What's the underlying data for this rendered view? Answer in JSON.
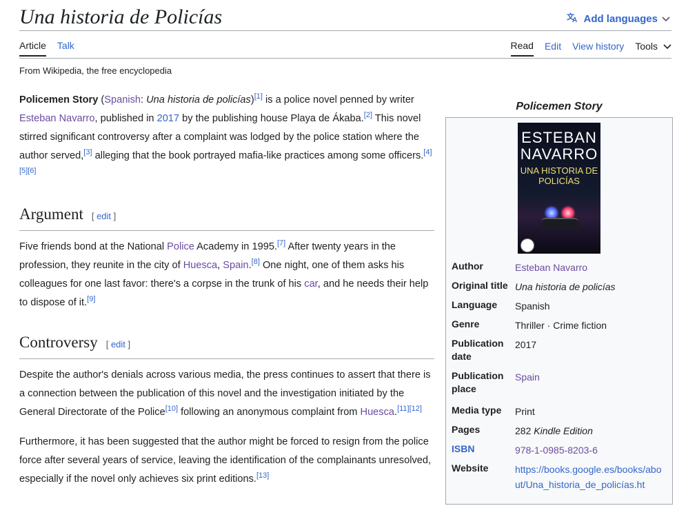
{
  "page": {
    "title": "Una historia de Policías",
    "add_languages": "Add languages",
    "tabs_left": [
      "Article",
      "Talk"
    ],
    "tabs_right": [
      "Read",
      "Edit",
      "View history",
      "Tools"
    ],
    "from": "From Wikipedia, the free encyclopedia"
  },
  "intro": {
    "bold": "Policemen Story",
    "lang_link": "Spanish",
    "italic": "Una historia de policías",
    "t1": " is a police novel penned by writer ",
    "author_link": "Esteban Navarro",
    "t2": ", published in ",
    "year_link": "2017",
    "t3": " by the publishing house Playa de Ákaba.",
    "t4": " This novel stirred significant controversy after a complaint was lodged by the police station where the author served,",
    "t5": " alleging that the book portrayed mafia-like practices among some officers.",
    "refs": [
      "[1]",
      "[2]",
      "[3]",
      "[4][5][6]"
    ]
  },
  "argument": {
    "heading": "Argument",
    "edit": "edit",
    "t1": "Five friends bond at the National ",
    "police_link": "Police",
    "t2": " Academy in 1995.",
    "t3": " After twenty years in the profession, they reunite in the city of ",
    "huesca_link": "Huesca",
    "spain_link": "Spain",
    "t4": " One night, one of them asks his colleagues for one last favor: there's a corpse in the trunk of his ",
    "car_link": "car",
    "t5": ", and he needs their help to dispose of it.",
    "refs": [
      "[7]",
      "[8]",
      "[9]"
    ]
  },
  "controversy": {
    "heading": "Controversy",
    "edit": "edit",
    "p1a": "Despite the author's denials across various media, the press continues to assert that there is a connection between the publication of this novel and the investigation initiated by the General Directorate of the Police",
    "p1b": " following an anonymous complaint from ",
    "huesca_link": "Huesca",
    "p2": "Furthermore, it has been suggested that the author might be forced to resign from the police force after several years of service, leaving the identification of the complainants unresolved, especially if the novel only achieves six print editions.",
    "refs": [
      "[10]",
      "[11][12]",
      "[13]"
    ]
  },
  "infobox": {
    "caption": "Policemen Story",
    "cover_author": "ESTEBAN NAVARRO",
    "cover_title": "UNA HISTORIA DE POLICÍAS",
    "rows": [
      {
        "label": "Author",
        "value": "Esteban Navarro"
      },
      {
        "label": "Original title",
        "value": "Una historia de policías"
      },
      {
        "label": "Language",
        "value": "Spanish"
      },
      {
        "label": "Genre",
        "value": "Thriller · Crime fiction"
      },
      {
        "label": "Publication date",
        "value": "2017"
      },
      {
        "label": "Publication place",
        "value": "Spain"
      },
      {
        "label": "Media type",
        "value": "Print"
      },
      {
        "label": "Pages",
        "value": "282",
        "value_extra": "Kindle Edition"
      },
      {
        "label": "ISBN",
        "value": "978-1-0985-8203-6"
      },
      {
        "label": "Website",
        "value": "https://books.google.es/books/about/Una_historia_de_policías.ht"
      }
    ]
  }
}
